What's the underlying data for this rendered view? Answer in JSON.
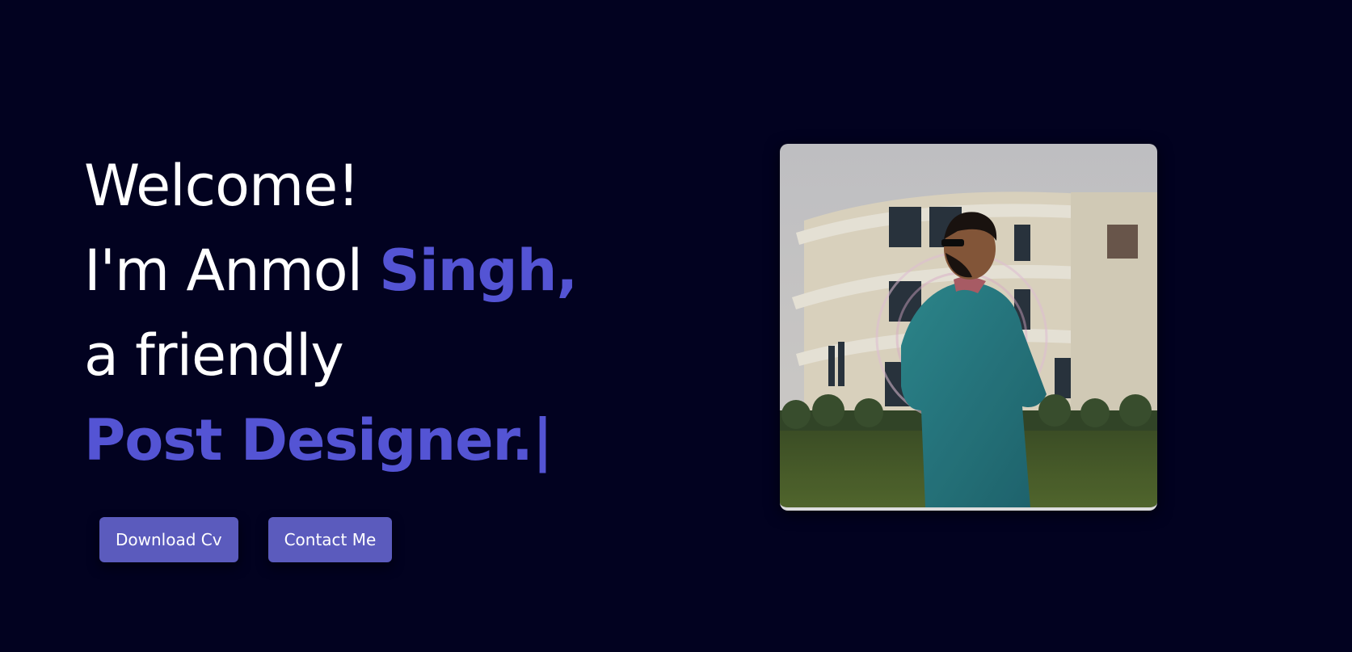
{
  "hero": {
    "welcome": "Welcome!",
    "intro_prefix": "I'm Anmol ",
    "name_highlight": "Singh,",
    "descriptor": "a friendly",
    "role": "Post Designer.",
    "cursor": "|"
  },
  "buttons": {
    "download_cv": "Download Cv",
    "contact_me": "Contact Me"
  },
  "profile_photo": {
    "description_icon": "person-photo"
  },
  "colors": {
    "background": "#020220",
    "accent": "#5454d4",
    "button": "#5b5bbd",
    "text": "#ffffff"
  }
}
